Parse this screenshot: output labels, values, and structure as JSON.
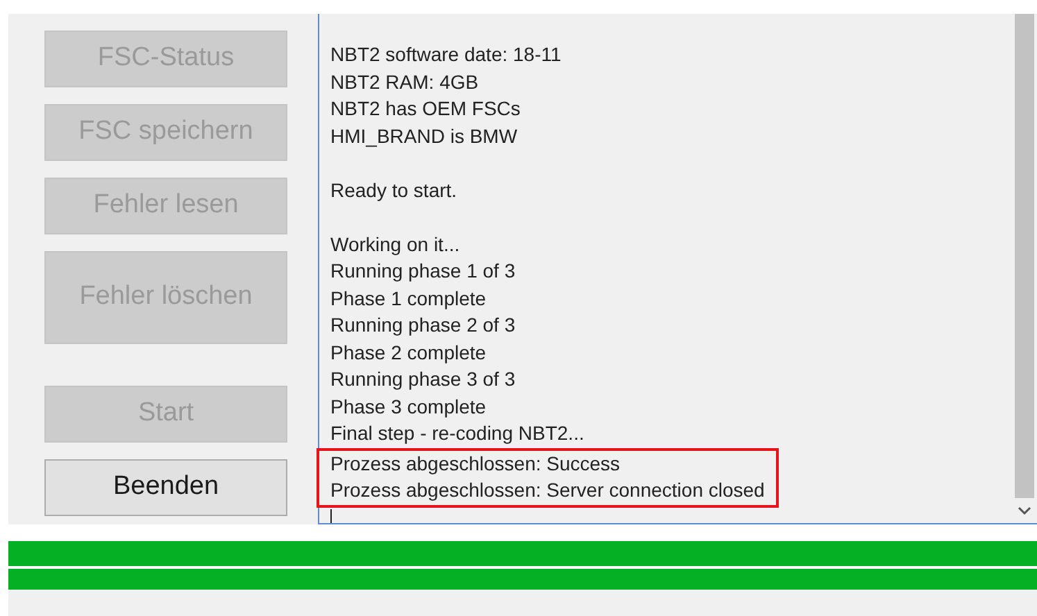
{
  "buttons": [
    {
      "label": "FSC-Status",
      "disabled": true,
      "kind": "normal"
    },
    {
      "label": "FSC speichern",
      "disabled": true,
      "kind": "normal"
    },
    {
      "label": "Fehler lesen",
      "disabled": true,
      "kind": "normal"
    },
    {
      "label": "Fehler löschen",
      "disabled": true,
      "kind": "tall"
    },
    {
      "label": "Start",
      "disabled": true,
      "kind": "normal"
    },
    {
      "label": "Beenden",
      "disabled": false,
      "kind": "normal"
    }
  ],
  "log": {
    "paragraphs": [
      [
        "NBT2 software date: 18-11",
        "NBT2 RAM: 4GB",
        "NBT2 has OEM FSCs",
        "HMI_BRAND is BMW"
      ],
      [
        "Ready to start."
      ],
      [
        "Working on it...",
        "Running phase 1 of 3",
        "Phase 1 complete",
        "Running phase 2 of 3",
        "Phase 2 complete",
        "Running phase 3 of 3",
        "Phase 3 complete",
        "Final step - re-coding NBT2..."
      ]
    ],
    "highlighted_lines": [
      "Prozess abgeschlossen: Success",
      "Prozess abgeschlossen: Server connection closed"
    ]
  },
  "progress_bars": [
    {
      "level": 1
    },
    {
      "level": 1
    }
  ]
}
